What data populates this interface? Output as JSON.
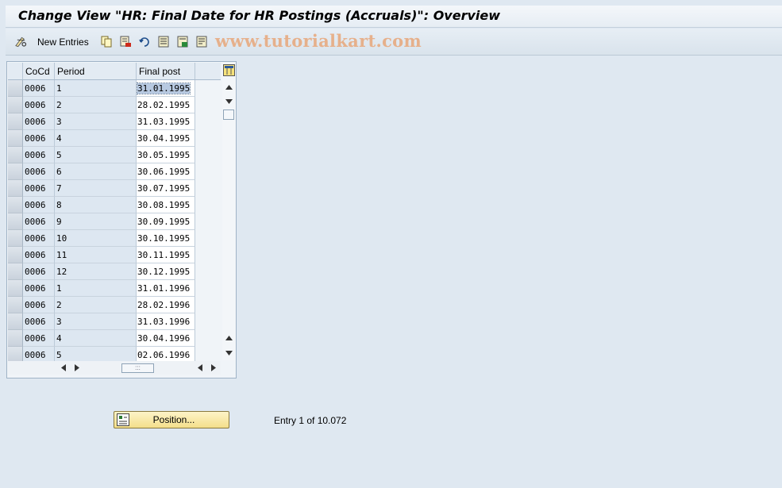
{
  "title": "Change View \"HR: Final Date for HR Postings (Accruals)\": Overview",
  "toolbar": {
    "new_entries_label": "New Entries",
    "watermark": "www.tutorialkart.com",
    "icons": [
      "edit-glasses-icon",
      "copy-icon",
      "delete-icon",
      "undo-icon",
      "select-all-icon",
      "select-block-icon",
      "deselect-all-icon"
    ]
  },
  "table": {
    "columns": [
      "CoCd",
      "Period",
      "Final post"
    ],
    "rows": [
      {
        "cocd": "0006",
        "period": "1",
        "final": "31.01.1995"
      },
      {
        "cocd": "0006",
        "period": "2",
        "final": "28.02.1995"
      },
      {
        "cocd": "0006",
        "period": "3",
        "final": "31.03.1995"
      },
      {
        "cocd": "0006",
        "period": "4",
        "final": "30.04.1995"
      },
      {
        "cocd": "0006",
        "period": "5",
        "final": "30.05.1995"
      },
      {
        "cocd": "0006",
        "period": "6",
        "final": "30.06.1995"
      },
      {
        "cocd": "0006",
        "period": "7",
        "final": "30.07.1995"
      },
      {
        "cocd": "0006",
        "period": "8",
        "final": "30.08.1995"
      },
      {
        "cocd": "0006",
        "period": "9",
        "final": "30.09.1995"
      },
      {
        "cocd": "0006",
        "period": "10",
        "final": "30.10.1995"
      },
      {
        "cocd": "0006",
        "period": "11",
        "final": "30.11.1995"
      },
      {
        "cocd": "0006",
        "period": "12",
        "final": "30.12.1995"
      },
      {
        "cocd": "0006",
        "period": "1",
        "final": "31.01.1996"
      },
      {
        "cocd": "0006",
        "period": "2",
        "final": "28.02.1996"
      },
      {
        "cocd": "0006",
        "period": "3",
        "final": "31.03.1996"
      },
      {
        "cocd": "0006",
        "period": "4",
        "final": "30.04.1996"
      },
      {
        "cocd": "0006",
        "period": "5",
        "final": "02.06.1996"
      }
    ]
  },
  "footer": {
    "position_button_label": "Position...",
    "entry_text": "Entry 1 of 10.072"
  }
}
